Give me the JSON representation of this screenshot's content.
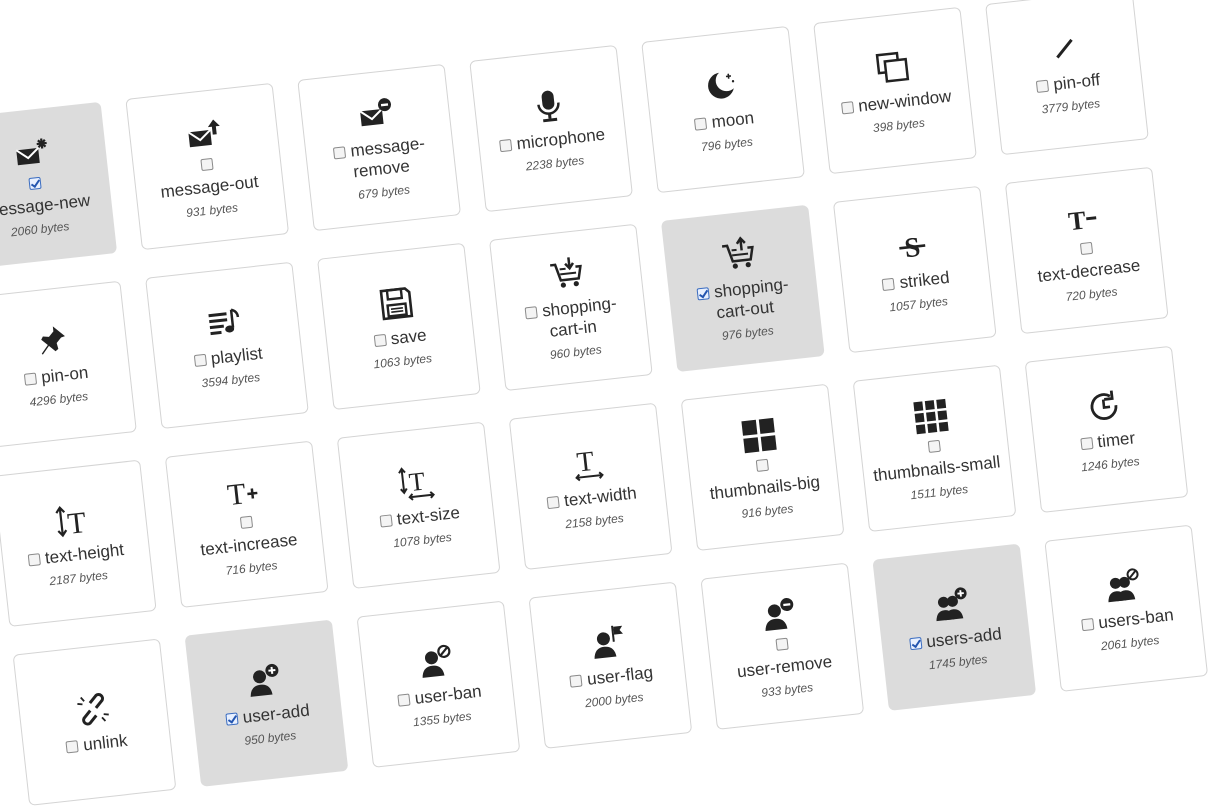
{
  "icons": [
    {
      "name": "message-new",
      "label": "message-new",
      "size": "2060 bytes",
      "selected": true,
      "layout": "block"
    },
    {
      "name": "message-out",
      "label": "message-out",
      "size": "931 bytes",
      "selected": false,
      "layout": "block"
    },
    {
      "name": "message-remove",
      "label": "message-remove",
      "label_1": "message-",
      "label_2": "remove",
      "size": "679 bytes",
      "selected": false,
      "layout": "wrap"
    },
    {
      "name": "microphone",
      "label": "microphone",
      "size": "2238 bytes",
      "selected": false,
      "layout": "inline"
    },
    {
      "name": "moon",
      "label": "moon",
      "size": "796 bytes",
      "selected": false,
      "layout": "inline"
    },
    {
      "name": "new-window",
      "label": "new-window",
      "size": "398 bytes",
      "selected": false,
      "layout": "inline"
    },
    {
      "name": "pin-off",
      "label": "pin-off",
      "size": "3779 bytes",
      "selected": false,
      "layout": "inline"
    },
    {
      "name": "pin-on",
      "label": "pin-on",
      "size": "4296 bytes",
      "selected": false,
      "layout": "inline"
    },
    {
      "name": "playlist",
      "label": "playlist",
      "size": "3594 bytes",
      "selected": false,
      "layout": "inline"
    },
    {
      "name": "save",
      "label": "save",
      "size": "1063 bytes",
      "selected": false,
      "layout": "inline"
    },
    {
      "name": "shopping-cart-in",
      "label": "shopping-cart-in",
      "label_1": "shopping-",
      "label_2": "cart-in",
      "size": "960 bytes",
      "selected": false,
      "layout": "wrap"
    },
    {
      "name": "shopping-cart-out",
      "label": "shopping-cart-out",
      "label_1": "shopping-",
      "label_2": "cart-out",
      "size": "976 bytes",
      "selected": true,
      "layout": "wrap"
    },
    {
      "name": "striked",
      "label": "striked",
      "size": "1057 bytes",
      "selected": false,
      "layout": "inline"
    },
    {
      "name": "text-decrease",
      "label": "text-decrease",
      "size": "720 bytes",
      "selected": false,
      "layout": "block"
    },
    {
      "name": "text-height",
      "label": "text-height",
      "size": "2187 bytes",
      "selected": false,
      "layout": "inline"
    },
    {
      "name": "text-increase",
      "label": "text-increase",
      "size": "716 bytes",
      "selected": false,
      "layout": "block"
    },
    {
      "name": "text-size",
      "label": "text-size",
      "size": "1078 bytes",
      "selected": false,
      "layout": "inline"
    },
    {
      "name": "text-width",
      "label": "text-width",
      "size": "2158 bytes",
      "selected": false,
      "layout": "inline"
    },
    {
      "name": "thumbnails-big",
      "label": "thumbnails-big",
      "size": "916 bytes",
      "selected": false,
      "layout": "block"
    },
    {
      "name": "thumbnails-small",
      "label": "thumbnails-small",
      "size": "1511 bytes",
      "selected": false,
      "layout": "block"
    },
    {
      "name": "timer",
      "label": "timer",
      "size": "1246 bytes",
      "selected": false,
      "layout": "inline"
    },
    {
      "name": "unlink",
      "label": "unlink",
      "size": "",
      "selected": false,
      "layout": "inline"
    },
    {
      "name": "user-add",
      "label": "user-add",
      "size": "950 bytes",
      "selected": true,
      "layout": "inline"
    },
    {
      "name": "user-ban",
      "label": "user-ban",
      "size": "1355 bytes",
      "selected": false,
      "layout": "inline"
    },
    {
      "name": "user-flag",
      "label": "user-flag",
      "size": "2000 bytes",
      "selected": false,
      "layout": "inline"
    },
    {
      "name": "user-remove",
      "label": "user-remove",
      "size": "933 bytes",
      "selected": false,
      "layout": "block"
    },
    {
      "name": "users-add",
      "label": "users-add",
      "size": "1745 bytes",
      "selected": true,
      "layout": "inline"
    },
    {
      "name": "users-ban",
      "label": "users-ban",
      "size": "2061 bytes",
      "selected": false,
      "layout": "inline"
    }
  ],
  "colors": {
    "card_selected_bg": "#dcdcdc",
    "card_bg": "#ffffff",
    "icon": "#222222",
    "checkbox_checked": "#2456b0"
  }
}
